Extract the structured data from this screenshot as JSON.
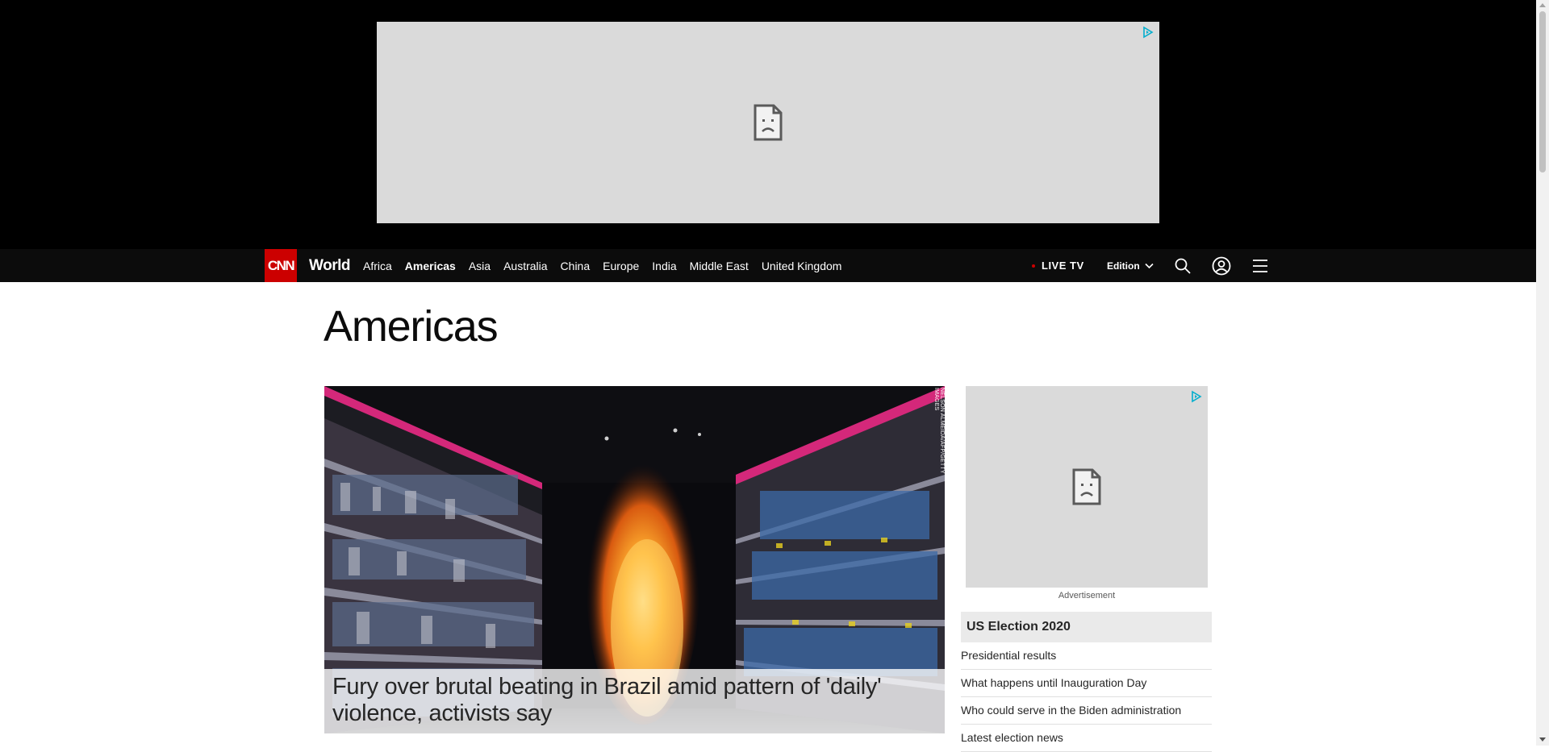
{
  "top_ad": {
    "label": ""
  },
  "nav": {
    "logo": "CNN",
    "section": "World",
    "links": [
      "Africa",
      "Americas",
      "Asia",
      "Australia",
      "China",
      "Europe",
      "India",
      "Middle East",
      "United Kingdom"
    ],
    "active_link": "Americas",
    "live_tv": "LIVE TV",
    "edition": "Edition"
  },
  "page": {
    "title": "Americas"
  },
  "hero": {
    "headline": "Fury over brutal beating in Brazil amid pattern of 'daily' violence, activists say",
    "photo_credit": "NELSON ALMEIDA/AFP/GETTY IMAGES"
  },
  "sidebar": {
    "ad_label": "Advertisement",
    "election": {
      "heading": "US Election 2020",
      "links": [
        "Presidential results",
        "What happens until Inauguration Day",
        "Who could serve in the Biden administration",
        "Latest election news"
      ]
    }
  },
  "colors": {
    "brand": "#cc0000",
    "nav_bg": "#0c0c0c",
    "ad_bg": "#dadada"
  }
}
